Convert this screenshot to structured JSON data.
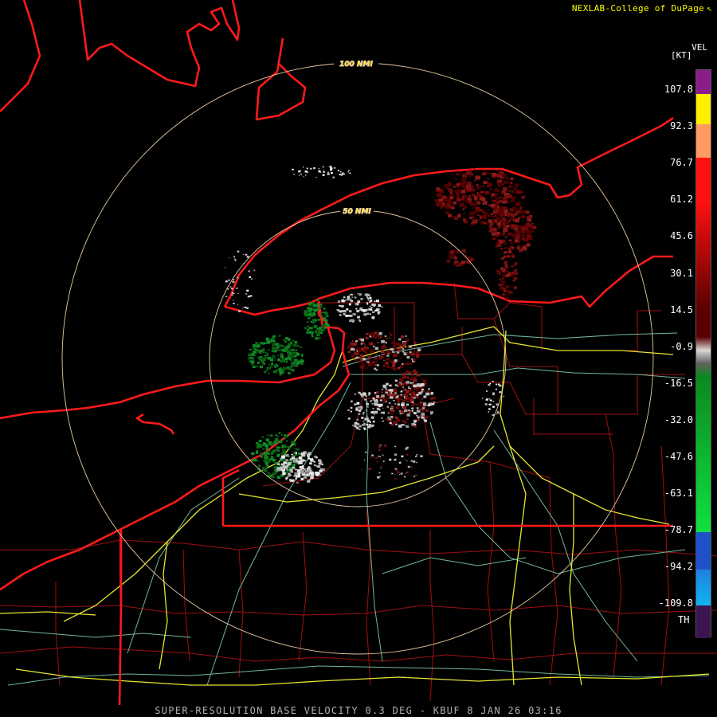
{
  "credit": {
    "text": "NEXLAB-College of DuPage",
    "icon": "pointer-cursor-icon"
  },
  "caption": "SUPER-RESOLUTION BASE VELOCITY 0.3 DEG - KBUF 8 JAN 26 03:16",
  "legend": {
    "product": "VEL",
    "unit": "[KT]",
    "ticks": [
      "107.8",
      "92.3",
      "76.7",
      "61.2",
      "45.6",
      "30.1",
      "14.5",
      "-0.9",
      "-16.5",
      "-32.0",
      "-47.6",
      "-63.1",
      "-78.7",
      "-94.2",
      "-109.8"
    ],
    "th": "TH",
    "colors": {
      "purple": "#8c1c8c",
      "yellow": "#ffee00",
      "orange": "#ff9a60",
      "red": "#ff1010",
      "dark_red": "#5a0000",
      "gray": "#d8d8d8",
      "green": "#0a8a1e",
      "blue": "#1e50c8",
      "cyan": "#10b4f0",
      "range_folded": "#3c1450"
    }
  },
  "range_rings": {
    "inner": "50 NMI",
    "outer": "100 NMI"
  },
  "radar_site": "KBUF",
  "map_colors": {
    "coastline": "#ff1a1a",
    "county": "#a01010",
    "interstate": "#e6e62e",
    "highway": "#70b896",
    "ring": "#e8c8a0"
  }
}
